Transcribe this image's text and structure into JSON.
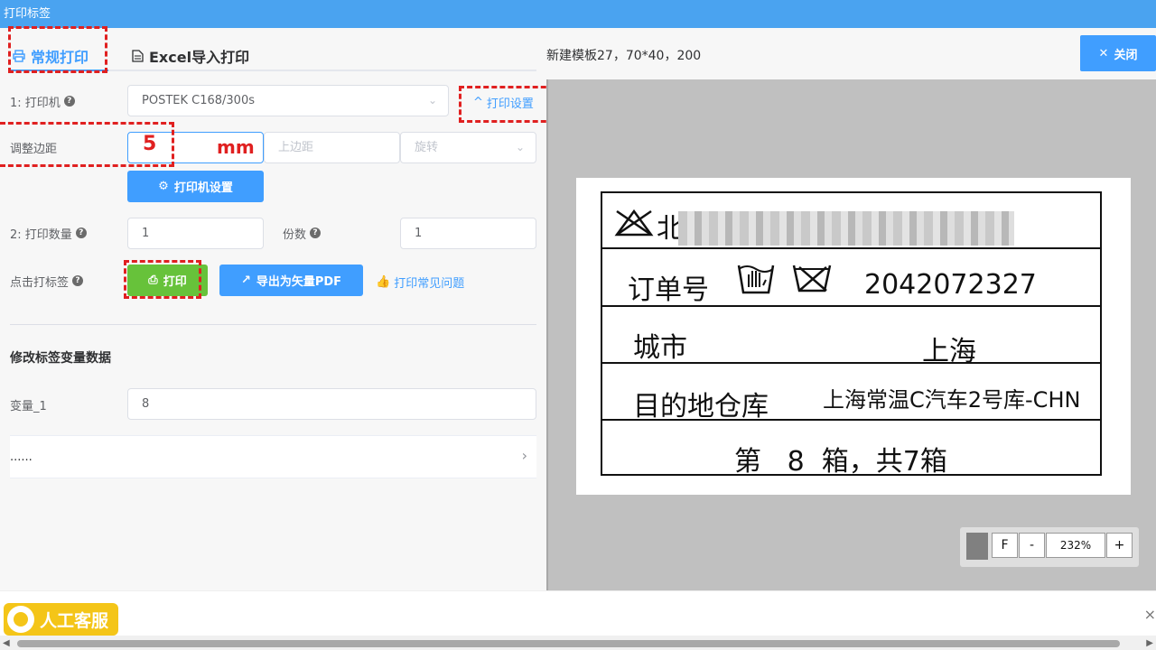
{
  "window": {
    "title": "打印标签"
  },
  "tabs": {
    "regular": "常规打印",
    "excel": "Excel导入打印"
  },
  "form": {
    "printer_label": "1: 打印机",
    "printer_value": "POSTEK C168/300s",
    "print_settings_link": "打印设置",
    "margin_label": "调整边距",
    "margin_value": "5",
    "margin_unit": "mm",
    "top_margin_placeholder": "上边距",
    "rotate_placeholder": "旋转",
    "printer_settings_button": "打印机设置",
    "quantity_label": "2: 打印数量",
    "quantity_value": "1",
    "copies_label": "份数",
    "copies_value": "1",
    "click_print_label": "点击打标签",
    "print_button": "打印",
    "export_pdf_button": "导出为矢量PDF",
    "faq_link": "打印常见问题"
  },
  "variables": {
    "section_title": "修改标签变量数据",
    "var1_label": "变量_1",
    "var1_value": "8",
    "more_text": "......"
  },
  "preview": {
    "template_title": "新建模板27，70*40，200",
    "close_button": "关闭",
    "label": {
      "row1_prefix": "北",
      "order_label": "订单号",
      "order_number": "2042072327",
      "city_label": "城市",
      "city_value": "上海",
      "dest_label": "目的地仓库",
      "dest_value": "上海常温C汽车2号库-CHN",
      "box_text": "第   8  箱，共7箱"
    },
    "zoom": {
      "fit": "F",
      "minus": "-",
      "value": "232%",
      "plus": "+"
    }
  },
  "support": {
    "label": "人工客服"
  },
  "colors": {
    "accent": "#409eff",
    "title_bar": "#4aa3f0",
    "print_green": "#67c23a",
    "highlight_red": "#e02020",
    "support_yellow": "#f4c518"
  }
}
